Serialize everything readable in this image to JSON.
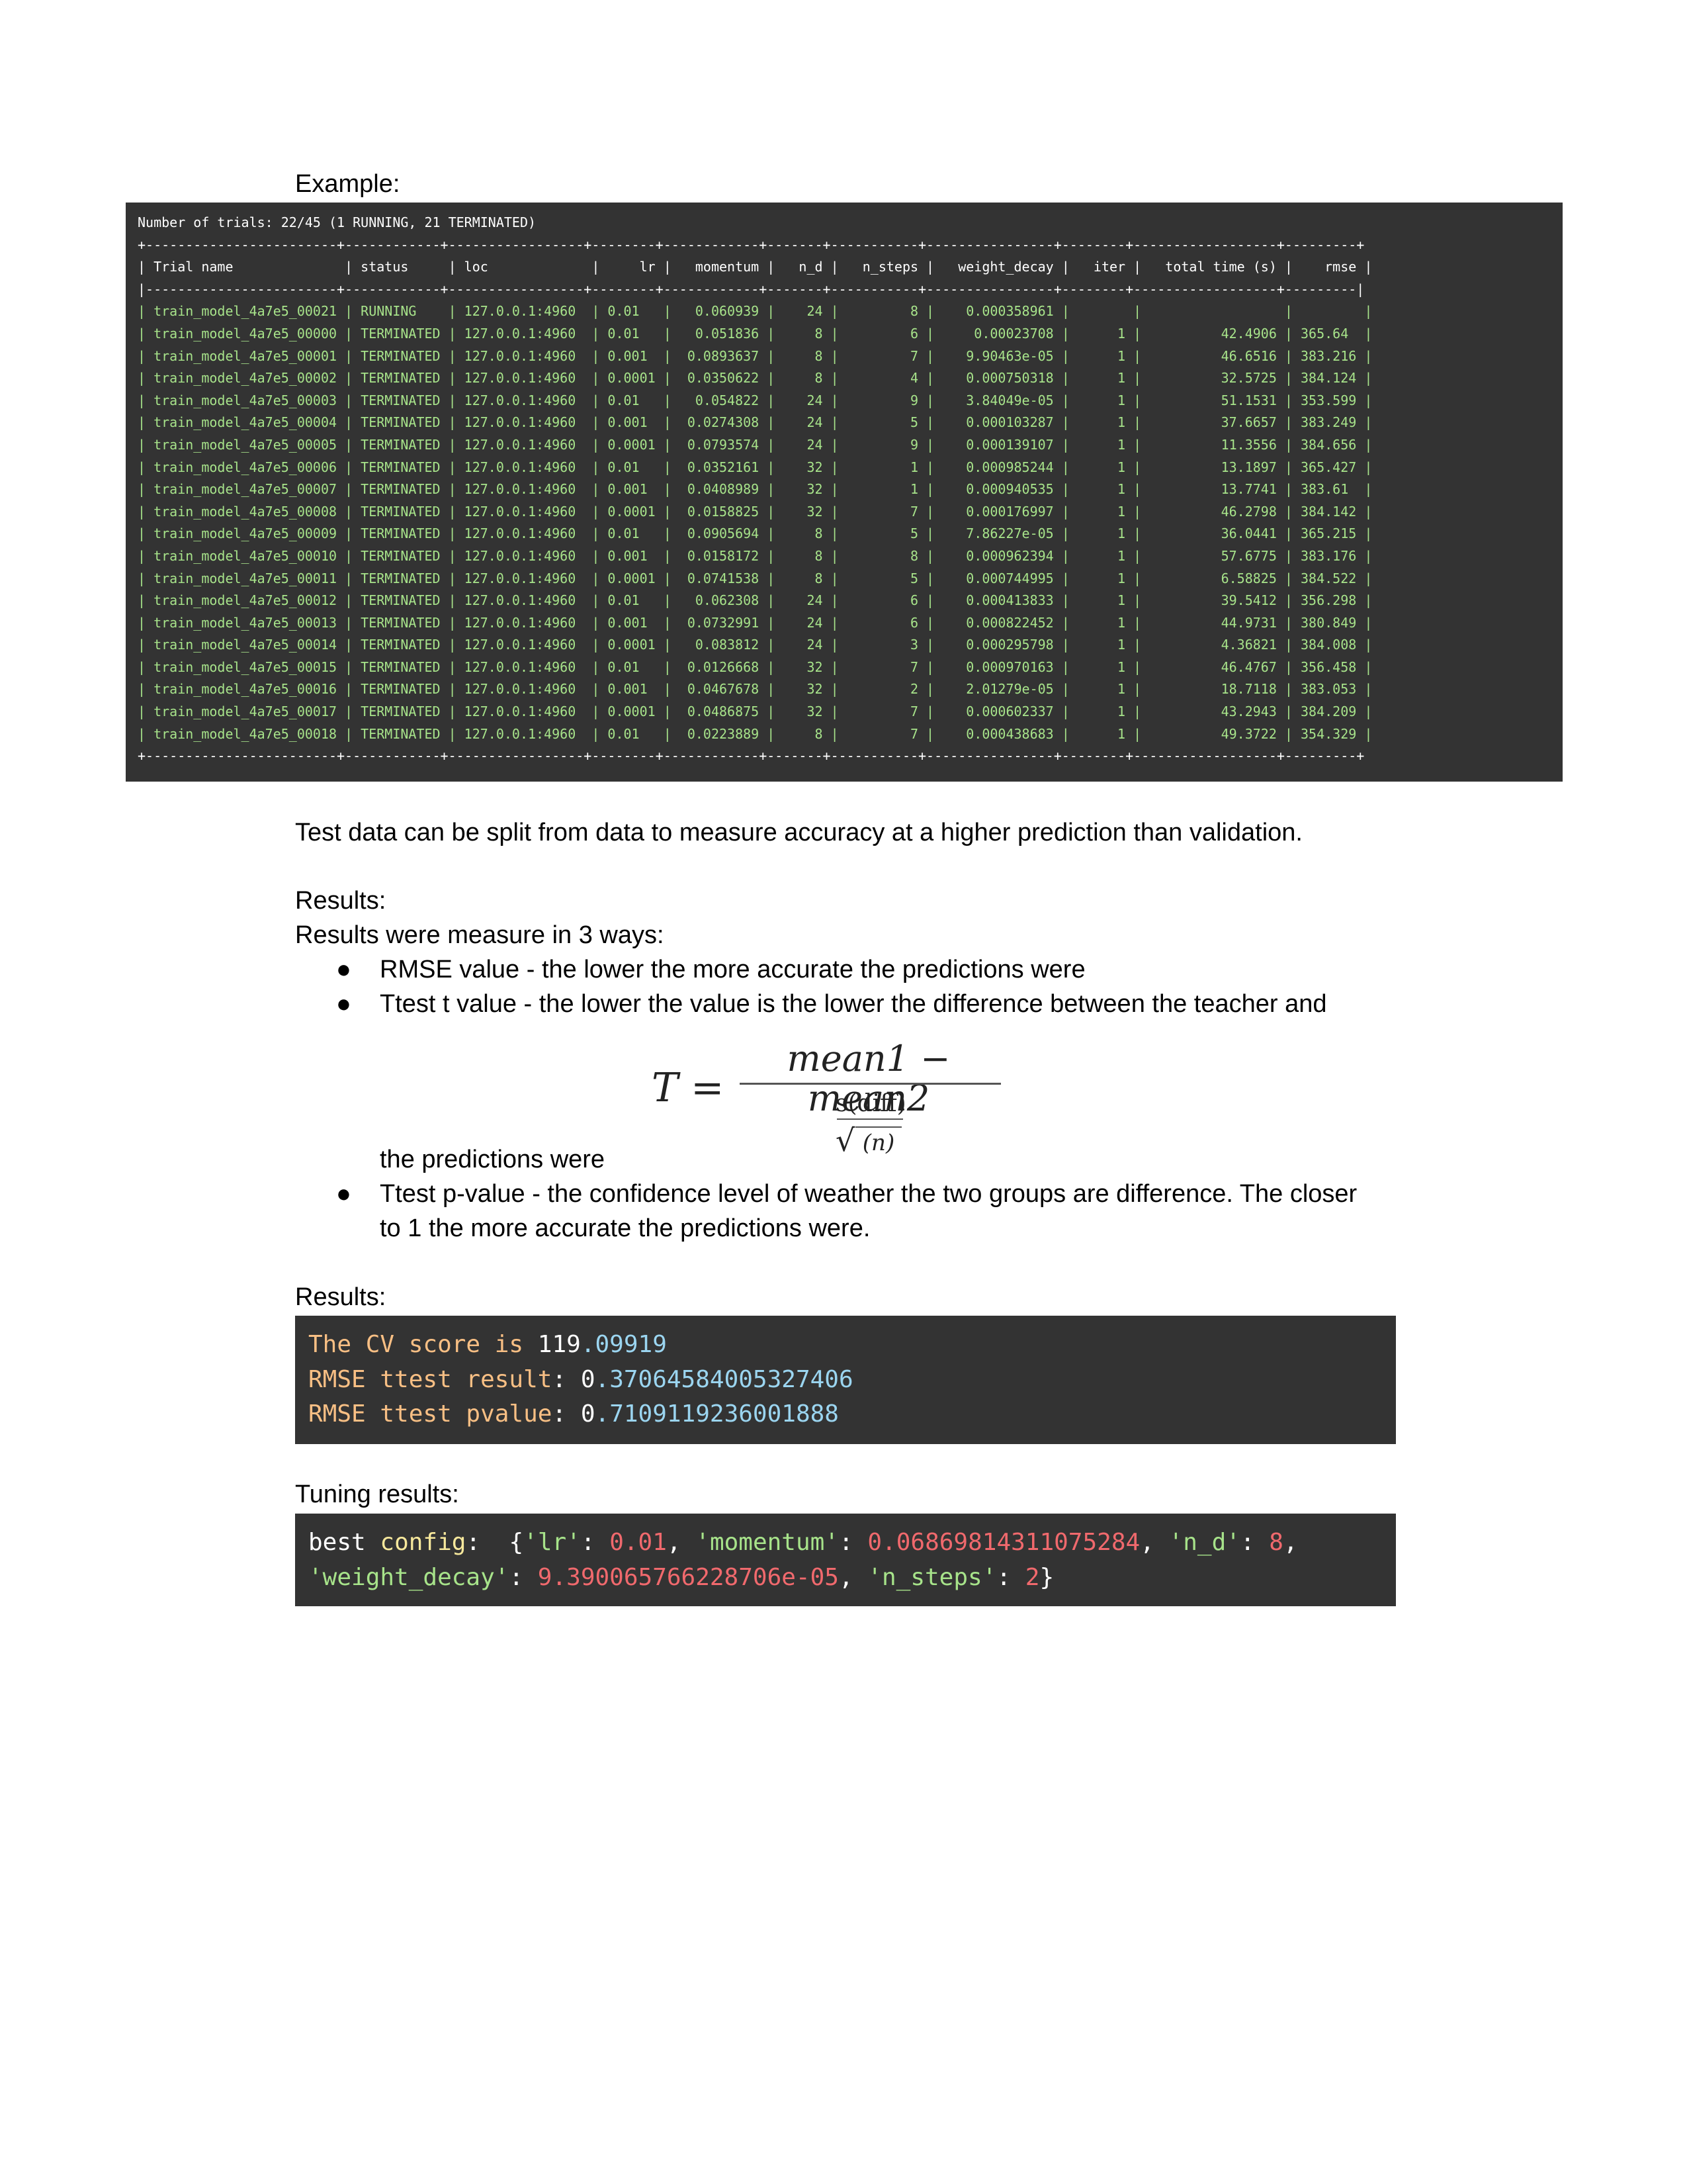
{
  "example_label": "Example:",
  "terminal": {
    "summary": "Number of trials: 22/45 (1 RUNNING, 21 TERMINATED)",
    "border": "+------------------------+------------+-----------------+--------+------------+-------+-----------+----------------+--------+------------------+---------+",
    "header_sep": "|------------------------+------------+-----------------+--------+------------+-------+-----------+----------------+--------+------------------+---------|",
    "columns": [
      "Trial name",
      "status",
      "loc",
      "lr",
      "momentum",
      "n_d",
      "n_steps",
      "weight_decay",
      "iter",
      "total time (s)",
      "rmse"
    ],
    "rows": [
      [
        "train_model_4a7e5_00021",
        "RUNNING",
        "127.0.0.1:4960",
        "0.01",
        "0.060939",
        "24",
        "8",
        "0.000358961",
        "",
        "",
        ""
      ],
      [
        "train_model_4a7e5_00000",
        "TERMINATED",
        "127.0.0.1:4960",
        "0.01",
        "0.051836",
        "8",
        "6",
        "0.00023708",
        "1",
        "42.4906",
        "365.64"
      ],
      [
        "train_model_4a7e5_00001",
        "TERMINATED",
        "127.0.0.1:4960",
        "0.001",
        "0.0893637",
        "8",
        "7",
        "9.90463e-05",
        "1",
        "46.6516",
        "383.216"
      ],
      [
        "train_model_4a7e5_00002",
        "TERMINATED",
        "127.0.0.1:4960",
        "0.0001",
        "0.0350622",
        "8",
        "4",
        "0.000750318",
        "1",
        "32.5725",
        "384.124"
      ],
      [
        "train_model_4a7e5_00003",
        "TERMINATED",
        "127.0.0.1:4960",
        "0.01",
        "0.054822",
        "24",
        "9",
        "3.84049e-05",
        "1",
        "51.1531",
        "353.599"
      ],
      [
        "train_model_4a7e5_00004",
        "TERMINATED",
        "127.0.0.1:4960",
        "0.001",
        "0.0274308",
        "24",
        "5",
        "0.000103287",
        "1",
        "37.6657",
        "383.249"
      ],
      [
        "train_model_4a7e5_00005",
        "TERMINATED",
        "127.0.0.1:4960",
        "0.0001",
        "0.0793574",
        "24",
        "9",
        "0.000139107",
        "1",
        "11.3556",
        "384.656"
      ],
      [
        "train_model_4a7e5_00006",
        "TERMINATED",
        "127.0.0.1:4960",
        "0.01",
        "0.0352161",
        "32",
        "1",
        "0.000985244",
        "1",
        "13.1897",
        "365.427"
      ],
      [
        "train_model_4a7e5_00007",
        "TERMINATED",
        "127.0.0.1:4960",
        "0.001",
        "0.0408989",
        "32",
        "1",
        "0.000940535",
        "1",
        "13.7741",
        "383.61"
      ],
      [
        "train_model_4a7e5_00008",
        "TERMINATED",
        "127.0.0.1:4960",
        "0.0001",
        "0.0158825",
        "32",
        "7",
        "0.000176997",
        "1",
        "46.2798",
        "384.142"
      ],
      [
        "train_model_4a7e5_00009",
        "TERMINATED",
        "127.0.0.1:4960",
        "0.01",
        "0.0905694",
        "8",
        "5",
        "7.86227e-05",
        "1",
        "36.0441",
        "365.215"
      ],
      [
        "train_model_4a7e5_00010",
        "TERMINATED",
        "127.0.0.1:4960",
        "0.001",
        "0.0158172",
        "8",
        "8",
        "0.000962394",
        "1",
        "57.6775",
        "383.176"
      ],
      [
        "train_model_4a7e5_00011",
        "TERMINATED",
        "127.0.0.1:4960",
        "0.0001",
        "0.0741538",
        "8",
        "5",
        "0.000744995",
        "1",
        "6.58825",
        "384.522"
      ],
      [
        "train_model_4a7e5_00012",
        "TERMINATED",
        "127.0.0.1:4960",
        "0.01",
        "0.062308",
        "24",
        "6",
        "0.000413833",
        "1",
        "39.5412",
        "356.298"
      ],
      [
        "train_model_4a7e5_00013",
        "TERMINATED",
        "127.0.0.1:4960",
        "0.001",
        "0.0732991",
        "24",
        "6",
        "0.000822452",
        "1",
        "44.9731",
        "380.849"
      ],
      [
        "train_model_4a7e5_00014",
        "TERMINATED",
        "127.0.0.1:4960",
        "0.0001",
        "0.083812",
        "24",
        "3",
        "0.000295798",
        "1",
        "4.36821",
        "384.008"
      ],
      [
        "train_model_4a7e5_00015",
        "TERMINATED",
        "127.0.0.1:4960",
        "0.01",
        "0.0126668",
        "32",
        "7",
        "0.000970163",
        "1",
        "46.4767",
        "356.458"
      ],
      [
        "train_model_4a7e5_00016",
        "TERMINATED",
        "127.0.0.1:4960",
        "0.001",
        "0.0467678",
        "32",
        "2",
        "2.01279e-05",
        "1",
        "18.7118",
        "383.053"
      ],
      [
        "train_model_4a7e5_00017",
        "TERMINATED",
        "127.0.0.1:4960",
        "0.0001",
        "0.0486875",
        "32",
        "7",
        "0.000602337",
        "1",
        "43.2943",
        "384.209"
      ],
      [
        "train_model_4a7e5_00018",
        "TERMINATED",
        "127.0.0.1:4960",
        "0.01",
        "0.0223889",
        "8",
        "7",
        "0.000438683",
        "1",
        "49.3722",
        "354.329"
      ]
    ]
  },
  "test_data_text": "Test data can be split from data to measure accuracy at a higher prediction than validation.",
  "results_label_1": "Results:",
  "results_intro": "Results were measure in 3 ways:",
  "bullets": [
    "RMSE value - the lower the more accurate the predictions were",
    "Ttest t value - the lower the value is the lower the difference between the teacher and",
    "Ttest p-value - the confidence level of weather the two groups are difference. The closer",
    "to 1 the more accurate the predictions were."
  ],
  "bullet_continuation": "the predictions were",
  "formula": {
    "lhs": "T =",
    "numerator": "mean1 − mean2",
    "inner_numerator": "s(diff)",
    "inner_denominator": "(n)"
  },
  "results_label_2": "Results:",
  "results_code": {
    "line1_prefix": "The CV score is",
    "line1_int": "119",
    "line1_frac": ".09919",
    "line2_prefix": "RMSE ttest result",
    "line2_int": "0",
    "line2_frac": ".37064584005327406",
    "line3_prefix": "RMSE ttest pvalue",
    "line3_int": "0",
    "line3_frac": ".7109119236001888"
  },
  "tuning_label": "Tuning results:",
  "tuning_code": {
    "kw_best": "best",
    "kw_config": "config",
    "k_lr": "'lr'",
    "v_lr": "0.01",
    "k_momentum": "'momentum'",
    "v_momentum": "0.06869814311075284",
    "k_nd": "'n_d'",
    "v_nd": "8",
    "k_wd": "'weight_decay'",
    "v_wd": "9.390065766228706e-05",
    "k_nsteps": "'n_steps'",
    "v_nsteps": "2"
  }
}
